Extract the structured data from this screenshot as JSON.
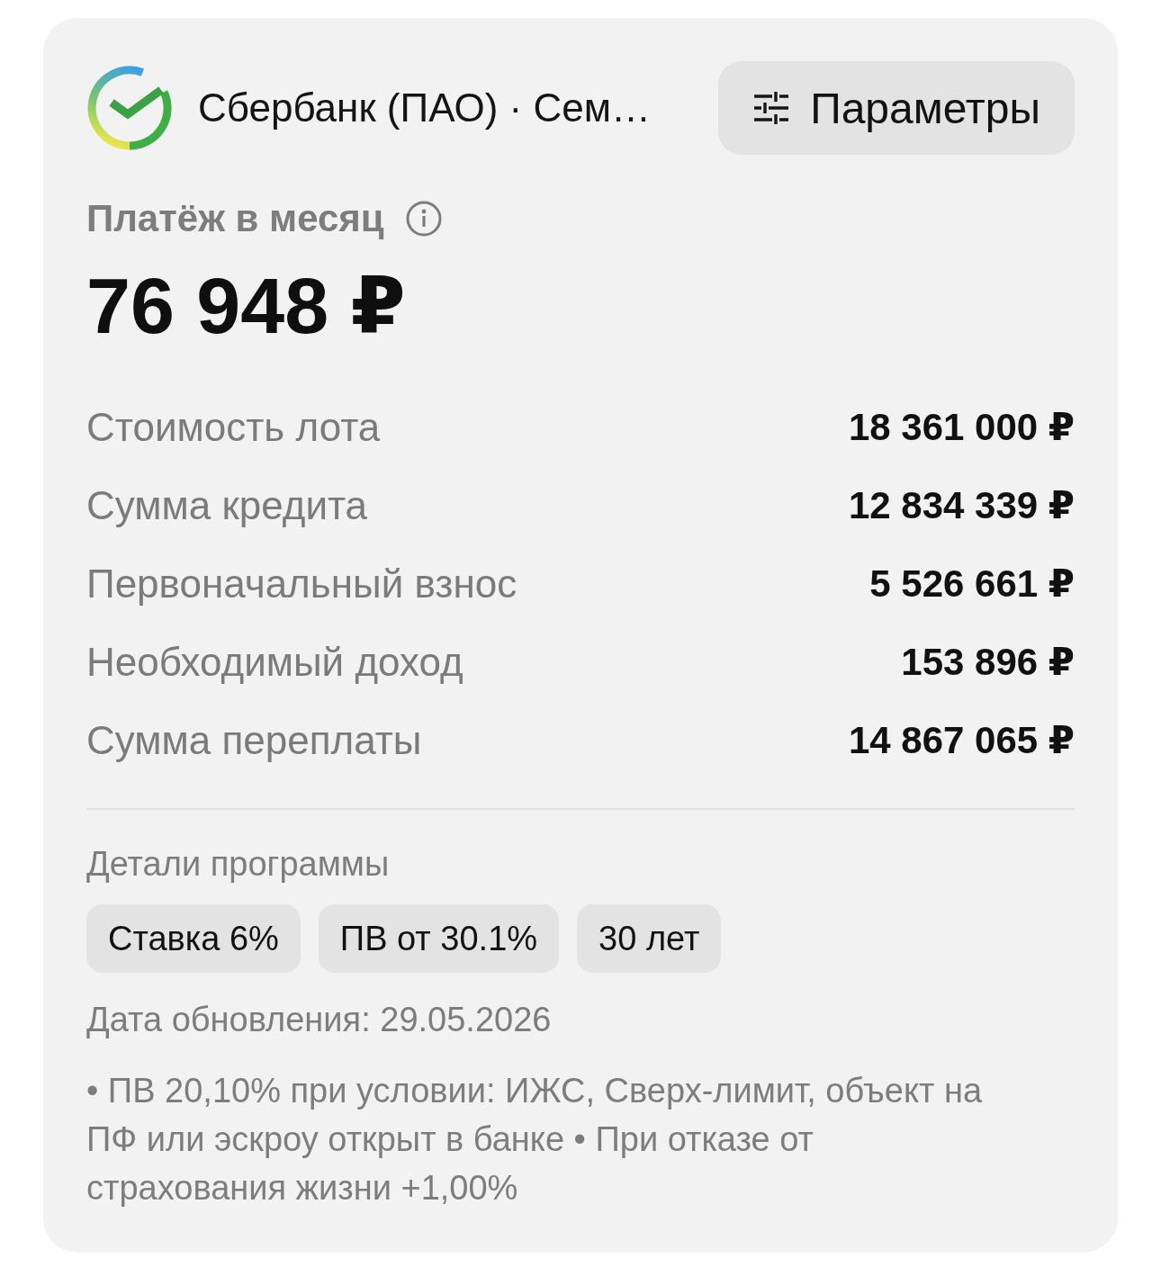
{
  "header": {
    "title": "Сбербанк (ПАО) · Сем…",
    "parameters_button": "Параметры"
  },
  "payment": {
    "label": "Платёж в месяц",
    "amount": "76 948 ₽"
  },
  "details": [
    {
      "label": "Стоимость лота",
      "value": "18 361 000 ₽"
    },
    {
      "label": "Сумма кредита",
      "value": "12 834 339 ₽"
    },
    {
      "label": "Первоначальный взнос",
      "value": "5 526 661 ₽"
    },
    {
      "label": "Необходимый доход",
      "value": "153 896 ₽"
    },
    {
      "label": "Сумма переплаты",
      "value": "14 867 065 ₽"
    }
  ],
  "program": {
    "title": "Детали программы",
    "chips": [
      "Ставка 6%",
      "ПВ от 30.1%",
      "30 лет"
    ]
  },
  "updated": "Дата обновления: 29.05.2026",
  "note": "• ПВ 20,10% при условии: ИЖС, Сверх-лимит, объект на ПФ или эскроу открыт в банке • При отказе от страхования жизни +1,00%"
}
